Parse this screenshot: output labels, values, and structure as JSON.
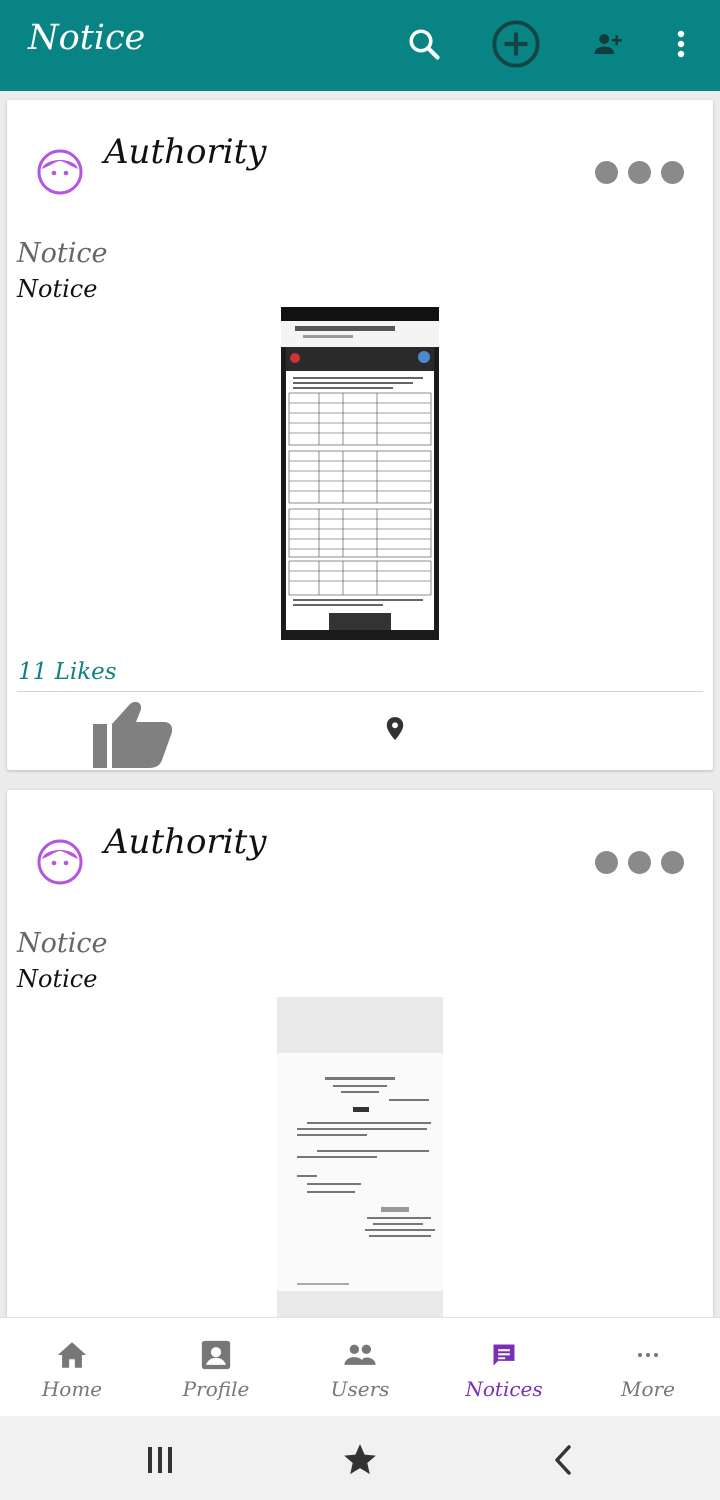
{
  "app": {
    "title": "Notice"
  },
  "toolbar": {
    "search_icon": "search-icon",
    "add_icon": "add-circle-icon",
    "add_user_icon": "person-add-icon",
    "menu_icon": "more-vert-icon"
  },
  "posts": [
    {
      "author": "Authority",
      "title": "Notice",
      "body": "Notice",
      "likes_text": "11 Likes",
      "image": "notice-screenshot-document"
    },
    {
      "author": "Authority",
      "title": "Notice",
      "body": "Notice",
      "image": "notice-paper-document"
    }
  ],
  "nav": {
    "items": [
      {
        "label": "Home",
        "icon": "home-icon"
      },
      {
        "label": "Profile",
        "icon": "profile-icon"
      },
      {
        "label": "Users",
        "icon": "users-icon"
      },
      {
        "label": "Notices",
        "icon": "notices-icon",
        "active": true
      },
      {
        "label": "More",
        "icon": "more-horiz-icon"
      }
    ]
  },
  "colors": {
    "primary": "#088484",
    "likes_text": "#128080",
    "active_nav": "#7b2fb8",
    "avatar": "#b457e0"
  },
  "system_nav": {
    "recents": "recents-icon",
    "home": "star-icon",
    "back": "back-icon"
  }
}
